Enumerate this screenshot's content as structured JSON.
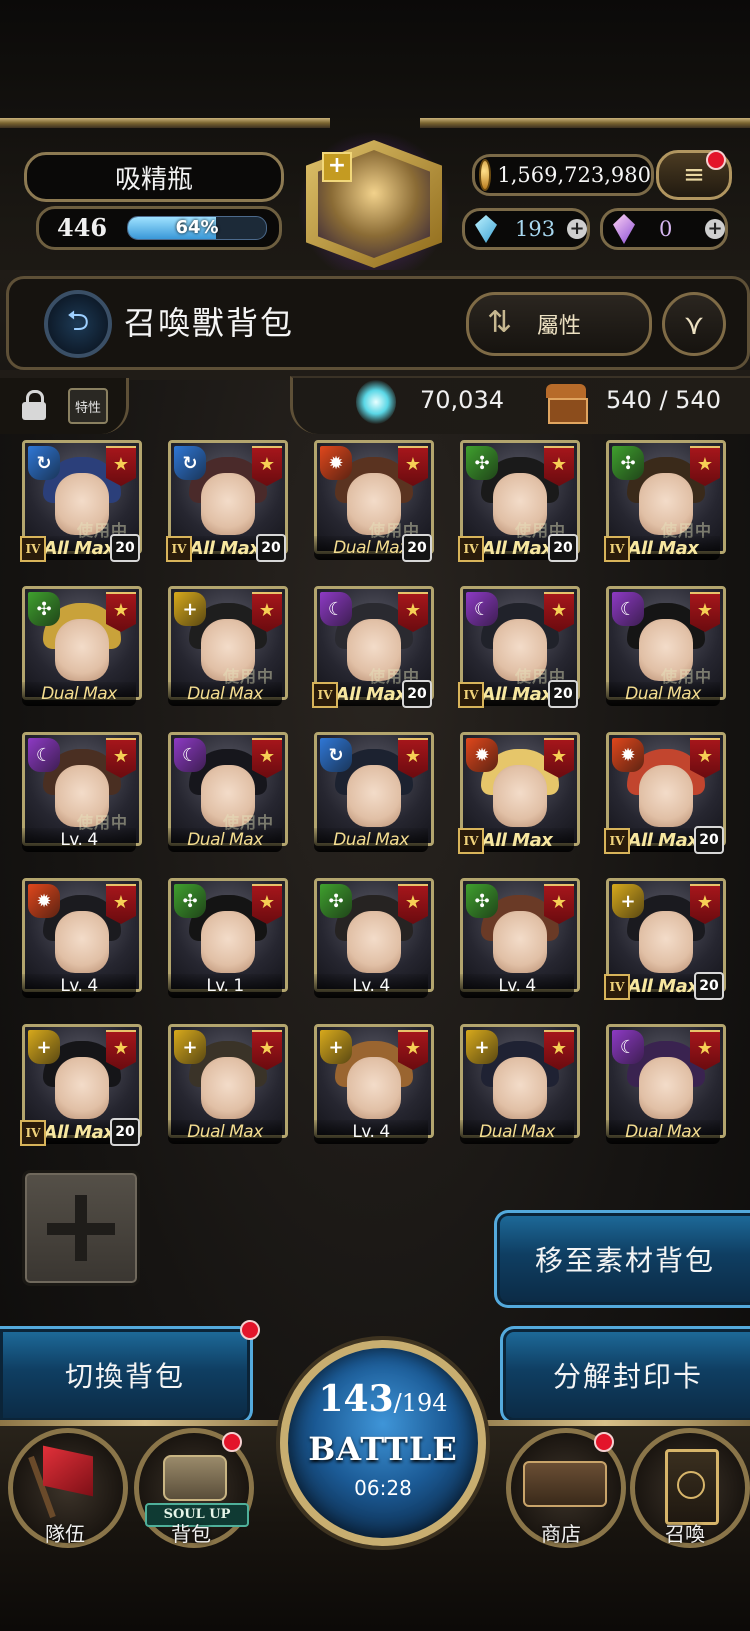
{
  "header": {
    "player_name": "吸精瓶",
    "level": "446",
    "exp_percent": 64,
    "exp_label": "64%",
    "coins": "1,569,723,980",
    "gems": "193",
    "crystals": "0",
    "menu_icon": "hamburger-icon"
  },
  "title_bar": {
    "title": "召喚獸背包",
    "sort_label": "屬性",
    "back_icon": "back-arrow-icon",
    "filter_icon": "filter-icon"
  },
  "info_bar": {
    "trait_label": "特性",
    "spirit_value": "70,034",
    "capacity": "540 / 540"
  },
  "cards": [
    {
      "element": "water",
      "label": "All Max",
      "rank": "IV",
      "lv": "20",
      "in_use": true,
      "hair": "#2b3f7a"
    },
    {
      "element": "water",
      "label": "All Max",
      "rank": "IV",
      "lv": "20",
      "in_use": false,
      "hair": "#4a2a2a"
    },
    {
      "element": "fire",
      "label": "Dual Max",
      "rank": "",
      "lv": "20",
      "in_use": true,
      "hair": "#5a3320"
    },
    {
      "element": "wood",
      "label": "All Max",
      "rank": "IV",
      "lv": "20",
      "in_use": true,
      "hair": "#1a1a1a"
    },
    {
      "element": "wood",
      "label": "All Max",
      "rank": "IV",
      "lv": "",
      "in_use": true,
      "hair": "#3a2a1a"
    },
    {
      "element": "wood",
      "label": "Dual Max",
      "rank": "",
      "lv": "",
      "in_use": false,
      "hair": "#c9a23a"
    },
    {
      "element": "light",
      "label": "Dual Max",
      "rank": "",
      "lv": "",
      "in_use": true,
      "hair": "#1e1e1e"
    },
    {
      "element": "dark",
      "label": "All Max",
      "rank": "IV",
      "lv": "20",
      "in_use": true,
      "hair": "#2a2a30"
    },
    {
      "element": "dark",
      "label": "All Max",
      "rank": "IV",
      "lv": "20",
      "in_use": true,
      "hair": "#20222a"
    },
    {
      "element": "dark",
      "label": "Dual Max",
      "rank": "",
      "lv": "",
      "in_use": true,
      "hair": "#151515"
    },
    {
      "element": "dark",
      "label": "Lv. 4",
      "rank": "",
      "lv": "",
      "in_use": true,
      "hair": "#4a2f22"
    },
    {
      "element": "dark",
      "label": "Dual Max",
      "rank": "",
      "lv": "",
      "in_use": true,
      "hair": "#16161c"
    },
    {
      "element": "water",
      "label": "Dual Max",
      "rank": "",
      "lv": "",
      "in_use": false,
      "hair": "#1c2230"
    },
    {
      "element": "fire",
      "label": "All Max",
      "rank": "IV",
      "lv": "",
      "in_use": false,
      "hair": "#e6c66a"
    },
    {
      "element": "fire",
      "label": "All Max",
      "rank": "IV",
      "lv": "20",
      "in_use": false,
      "hair": "#c2452e"
    },
    {
      "element": "fire",
      "label": "Lv. 4",
      "rank": "",
      "lv": "",
      "in_use": false,
      "hair": "#1b1b1f"
    },
    {
      "element": "wood",
      "label": "Lv. 1",
      "rank": "",
      "lv": "",
      "in_use": false,
      "hair": "#141414"
    },
    {
      "element": "wood",
      "label": "Lv. 4",
      "rank": "",
      "lv": "",
      "in_use": false,
      "hair": "#262322"
    },
    {
      "element": "wood",
      "label": "Lv. 4",
      "rank": "",
      "lv": "",
      "in_use": false,
      "hair": "#6a3a26"
    },
    {
      "element": "light",
      "label": "All Max",
      "rank": "IV",
      "lv": "20",
      "in_use": false,
      "hair": "#1a1a1f"
    },
    {
      "element": "light",
      "label": "All Max",
      "rank": "IV",
      "lv": "20",
      "in_use": false,
      "hair": "#151518"
    },
    {
      "element": "light",
      "label": "Dual Max",
      "rank": "",
      "lv": "",
      "in_use": false,
      "hair": "#3a3328"
    },
    {
      "element": "light",
      "label": "Lv. 4",
      "rank": "",
      "lv": "",
      "in_use": false,
      "hair": "#9a6530"
    },
    {
      "element": "light",
      "label": "Dual Max",
      "rank": "",
      "lv": "",
      "in_use": false,
      "hair": "#1f2233"
    },
    {
      "element": "dark",
      "label": "Dual Max",
      "rank": "",
      "lv": "",
      "in_use": false,
      "hair": "#3a2350"
    }
  ],
  "in_use_text": "使用中",
  "element_colors": {
    "water": "#2f77d6",
    "fire": "#e0471c",
    "wood": "#3fa02e",
    "light": "#d7a91c",
    "dark": "#8d3ac4"
  },
  "element_glyphs": {
    "water": "↻",
    "fire": "✹",
    "wood": "✣",
    "light": "+",
    "dark": "☾"
  },
  "actions": {
    "move_to_material": "移至素材背包",
    "switch_bag": "切換背包",
    "decompose": "分解封印卡"
  },
  "battle": {
    "stamina_current": "143",
    "stamina_max": "/194",
    "label": "BATTLE",
    "timer": "06:28"
  },
  "nav": {
    "team": "隊伍",
    "bag": "背包",
    "bag_badge": "SOUL UP",
    "shop": "商店",
    "summon": "召喚"
  }
}
